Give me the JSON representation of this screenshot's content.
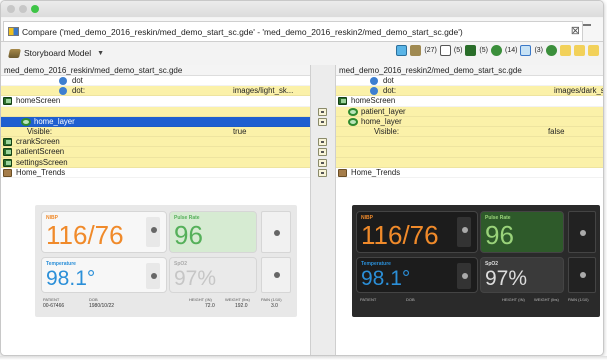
{
  "window": {
    "tab_title": "Compare ('med_demo_2016_reskin/med_demo_start_sc.gde' - 'med_demo_2016_reskin2/med_demo_start_sc.gde')"
  },
  "toolbar": {
    "model_label": "Storyboard Model",
    "counts": [
      "(27)",
      "(5)",
      "(5)",
      "(14)",
      "(3)"
    ]
  },
  "left": {
    "header": "med_demo_2016_reskin/med_demo_start_sc.gde",
    "rows": [
      {
        "label": "dot",
        "value": "",
        "icon": "dot",
        "indent": 58,
        "style": "white"
      },
      {
        "label": "dot:",
        "value": "images/light_sk...",
        "icon": "dot",
        "indent": 58,
        "style": "yel"
      },
      {
        "label": "homeScreen",
        "value": "",
        "icon": "screen",
        "indent": 2,
        "style": "white"
      },
      {
        "label": "",
        "value": "",
        "icon": "",
        "indent": 0,
        "style": "yel"
      },
      {
        "label": "home_layer",
        "value": "",
        "icon": "layer",
        "indent": 20,
        "style": "sel"
      },
      {
        "label": "Visible:",
        "value": "true",
        "icon": "",
        "indent": 26,
        "style": "yel"
      },
      {
        "label": "crankScreen",
        "value": "",
        "icon": "screen",
        "indent": 2,
        "style": "yel"
      },
      {
        "label": "patientScreen",
        "value": "",
        "icon": "screen",
        "indent": 2,
        "style": "yel"
      },
      {
        "label": "settingsScreen",
        "value": "",
        "icon": "screen",
        "indent": 2,
        "style": "yel"
      },
      {
        "label": "Home_Trends",
        "value": "",
        "icon": "trend",
        "indent": 2,
        "style": "white"
      }
    ],
    "preview": {
      "nibp": "116/76",
      "nibp_label": "NIBP",
      "pulse_label": "Pulse Rate",
      "pulse": "96",
      "temp_label": "Temperature",
      "temp": "98.1°",
      "spo2_label": "SpO2",
      "spo2": "97%",
      "patient_label": "PATIENT",
      "patient": "00-67466",
      "dob_label": "DOB",
      "dob": "1980/10/22",
      "height_label": "HEIGHT (IN)",
      "height": "72.0",
      "weight_label": "WEIGHT (lbs)",
      "weight": "192.0",
      "pain_label": "PAIN (1/10)",
      "pain": "3.0"
    }
  },
  "right": {
    "header": "med_demo_2016_reskin2/med_demo_start_sc.gde",
    "rows": [
      {
        "label": "dot",
        "value": "",
        "icon": "dot",
        "indent": 34,
        "style": "white"
      },
      {
        "label": "dot:",
        "value": "images/dark_s...",
        "icon": "dot",
        "indent": 34,
        "style": "yel"
      },
      {
        "label": "homeScreen",
        "value": "",
        "icon": "screen",
        "indent": 2,
        "style": "white"
      },
      {
        "label": "patient_layer",
        "value": "",
        "icon": "layer",
        "indent": 12,
        "style": "yel"
      },
      {
        "label": "home_layer",
        "value": "",
        "icon": "layer",
        "indent": 12,
        "style": "yel"
      },
      {
        "label": "Visible:",
        "value": "false",
        "icon": "",
        "indent": 38,
        "style": "yel"
      },
      {
        "label": "",
        "value": "",
        "icon": "",
        "indent": 0,
        "style": "yel"
      },
      {
        "label": "",
        "value": "",
        "icon": "",
        "indent": 0,
        "style": "yel"
      },
      {
        "label": "",
        "value": "",
        "icon": "",
        "indent": 0,
        "style": "yel"
      },
      {
        "label": "Home_Trends",
        "value": "",
        "icon": "trend",
        "indent": 2,
        "style": "white"
      }
    ],
    "preview": {
      "nibp_label": "NIBP",
      "nibp": "116/76",
      "pulse_label": "Pulse Rate",
      "pulse": "96",
      "temp_label": "Temperature",
      "temp": "98.1°",
      "spo2_label": "SpO2",
      "spo2": "97%",
      "patient_label": "PATIENT",
      "dob_label": "DOB",
      "height_label": "HEIGHT (IN)",
      "weight_label": "WEIGHT (lbs)",
      "pain_label": "PAIN (1/10)"
    }
  },
  "gutter_rows": [
    false,
    false,
    false,
    true,
    true,
    false,
    true,
    true,
    true,
    true
  ],
  "colors": {
    "diff_yellow": "#fbf1a9",
    "selection": "#1f5fd0",
    "nibp": "#f08a2a",
    "pulse": "#55b05a",
    "temp": "#2b8fd8",
    "spo2": "#b9b9b9"
  }
}
